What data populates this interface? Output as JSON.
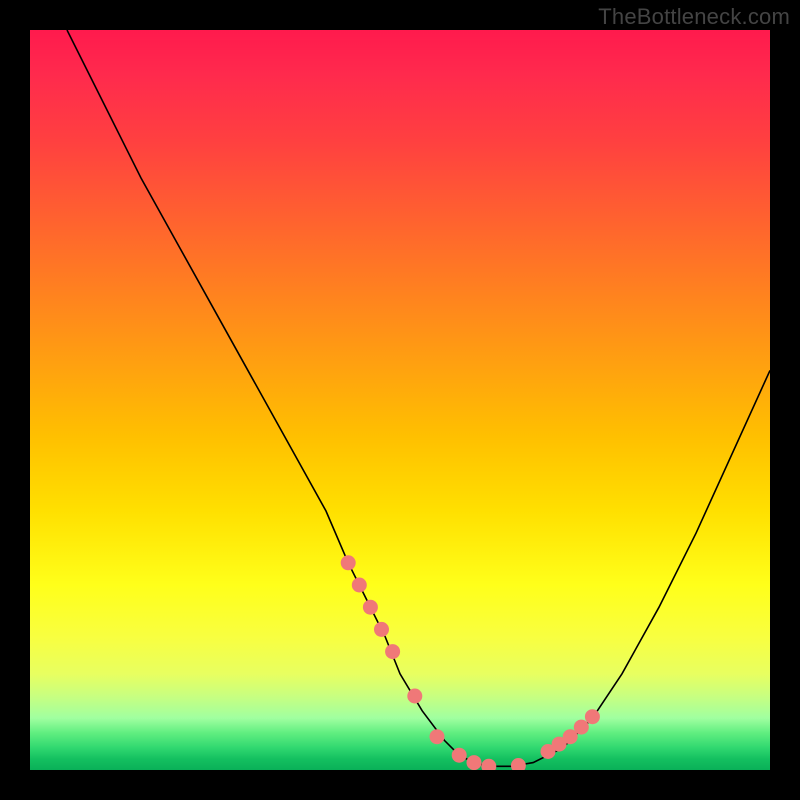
{
  "watermark": "TheBottleneck.com",
  "chart_data": {
    "type": "line",
    "title": "",
    "xlabel": "",
    "ylabel": "",
    "xlim": [
      0,
      100
    ],
    "ylim": [
      0,
      100
    ],
    "series": [
      {
        "name": "curve",
        "x": [
          5,
          10,
          15,
          20,
          25,
          30,
          35,
          40,
          43,
          45,
          48,
          50,
          53,
          56,
          58,
          60,
          62,
          65,
          68,
          72,
          76,
          80,
          85,
          90,
          95,
          100
        ],
        "y": [
          100,
          90,
          80,
          71,
          62,
          53,
          44,
          35,
          28,
          24,
          18,
          13,
          8,
          4,
          2,
          1,
          0.5,
          0.5,
          1,
          3,
          7,
          13,
          22,
          32,
          43,
          54
        ]
      }
    ],
    "dots": {
      "name": "highlight-points",
      "color": "#f07878",
      "x": [
        43,
        44.5,
        46,
        47.5,
        49,
        52,
        55,
        58,
        60,
        62,
        66,
        70,
        71.5,
        73,
        74.5,
        76
      ],
      "y": [
        28,
        25,
        22,
        19,
        16,
        10,
        4.5,
        2,
        1,
        0.5,
        0.6,
        2.5,
        3.5,
        4.5,
        5.8,
        7.2
      ]
    }
  }
}
